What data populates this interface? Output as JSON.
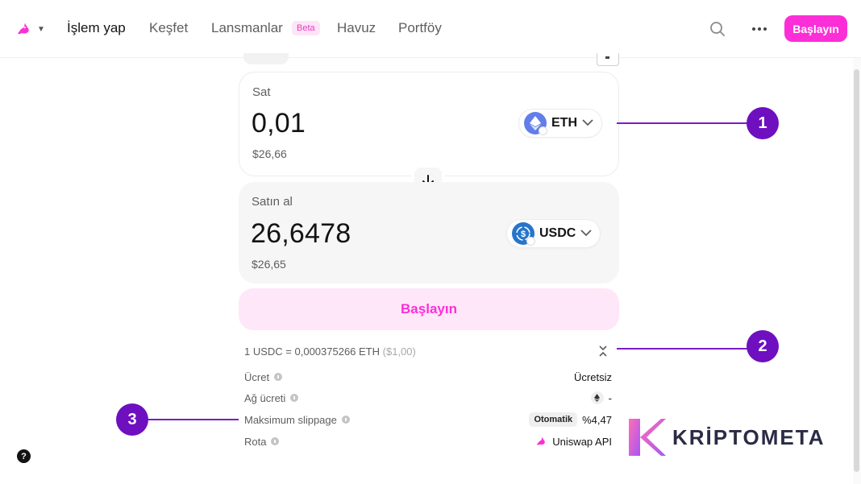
{
  "nav": {
    "links": [
      "İşlem yap",
      "Keşfet",
      "Lansmanlar",
      "Havuz",
      "Portföy"
    ],
    "beta_badge": "Beta",
    "start_label": "Başlayın"
  },
  "swap": {
    "sell": {
      "label": "Sat",
      "amount": "0,01",
      "usd": "$26,66",
      "token": "ETH"
    },
    "buy": {
      "label": "Satın al",
      "amount": "26,6478",
      "usd": "$26,65",
      "token": "USDC"
    },
    "cta_label": "Başlayın"
  },
  "details": {
    "rate": "1 USDC = 0,000375266 ETH",
    "rate_usd": "($1,00)",
    "rows": [
      {
        "label": "Ücret",
        "value": "Ücretsiz"
      },
      {
        "label": "Ağ ücreti",
        "value": "-"
      },
      {
        "label": "Maksimum slippage",
        "badge": "Otomatik",
        "value": "%4,47"
      },
      {
        "label": "Rota",
        "value": "Uniswap API"
      }
    ]
  },
  "annotations": [
    "1",
    "2",
    "3"
  ],
  "help": "?",
  "watermark": "KRİPTOMETA",
  "colors": {
    "brand_pink": "#fc2ed7",
    "annotation_purple": "#6e0fc0"
  }
}
